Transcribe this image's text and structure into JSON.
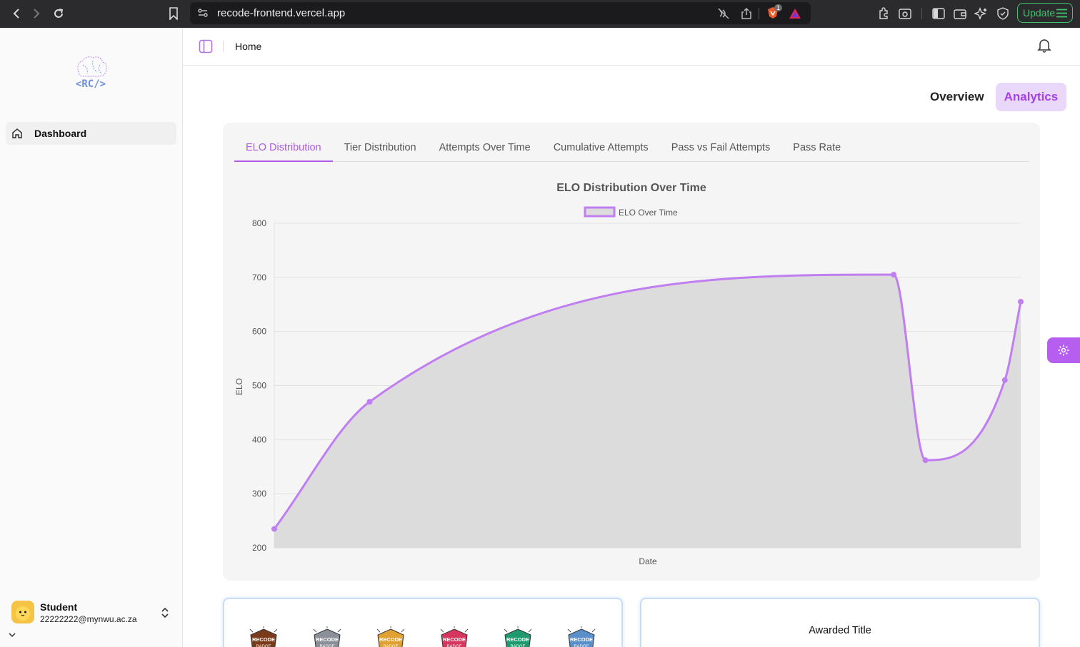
{
  "browser": {
    "url": "recode-frontend.vercel.app",
    "update_label": "Update",
    "brave_badge_count": "1"
  },
  "sidebar": {
    "logo_text": "<RC/>",
    "nav": [
      {
        "label": "Dashboard",
        "icon": "home-icon"
      }
    ],
    "user": {
      "name": "Student",
      "email": "22222222@mynwu.ac.za"
    }
  },
  "header": {
    "breadcrumb": "Home"
  },
  "view_tabs": [
    {
      "label": "Overview",
      "active": false
    },
    {
      "label": "Analytics",
      "active": true
    }
  ],
  "chart_tabs": [
    {
      "label": "ELO Distribution",
      "active": true
    },
    {
      "label": "Tier Distribution",
      "active": false
    },
    {
      "label": "Attempts Over Time",
      "active": false
    },
    {
      "label": "Cumulative Attempts",
      "active": false
    },
    {
      "label": "Pass vs Fail Attempts",
      "active": false
    },
    {
      "label": "Pass Rate",
      "active": false
    }
  ],
  "chart_data": {
    "type": "line",
    "title": "ELO Distribution Over Time",
    "xlabel": "Date",
    "ylabel": "ELO",
    "ylim": [
      200,
      800
    ],
    "yticks": [
      200,
      300,
      400,
      500,
      600,
      700,
      800
    ],
    "grid": true,
    "legend": "top",
    "line_color": "#c07ef0",
    "fill_color": "#dcdcdc",
    "series": [
      {
        "name": "ELO Over Time",
        "x_index": [
          0,
          6,
          39,
          41,
          46,
          47
        ],
        "x_total": 47,
        "values": [
          235,
          470,
          705,
          362,
          510,
          655
        ]
      }
    ]
  },
  "bottom": {
    "badges": [
      {
        "label": "RECODE BADGE",
        "color": "#7a3b1a"
      },
      {
        "label": "RECODE BADGE",
        "color": "#8a8f98"
      },
      {
        "label": "RECODE BADGE",
        "color": "#e0a132"
      },
      {
        "label": "RECODE BADGE",
        "color": "#d6365e"
      },
      {
        "label": "RECODE BADGE",
        "color": "#1f9a6e"
      },
      {
        "label": "RECODE BADGE",
        "color": "#5a8fc9"
      }
    ],
    "awarded_title": "Awarded Title"
  }
}
